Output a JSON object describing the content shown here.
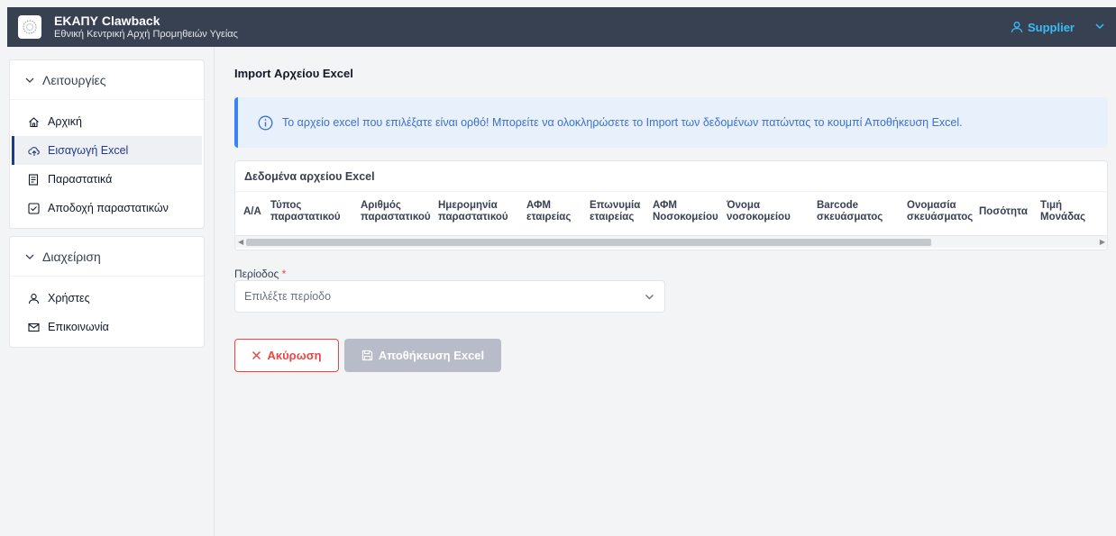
{
  "header": {
    "title": "ΕΚΑΠΥ Clawback",
    "subtitle": "Εθνική Κεντρική Αρχή Προμηθειών Υγείας",
    "user_label": "Supplier"
  },
  "sidebar": {
    "sections": [
      {
        "title": "Λειτουργίες",
        "items": [
          {
            "label": "Αρχική",
            "icon": "home-icon"
          },
          {
            "label": "Εισαγωγή Excel",
            "icon": "cloud-upload-icon",
            "active": true
          },
          {
            "label": "Παραστατικά",
            "icon": "receipt-icon"
          },
          {
            "label": "Αποδοχή παραστατικών",
            "icon": "check-square-icon"
          }
        ]
      },
      {
        "title": "Διαχείριση",
        "items": [
          {
            "label": "Χρήστες",
            "icon": "user-icon"
          },
          {
            "label": "Επικοινωνία",
            "icon": "mail-icon"
          }
        ]
      }
    ]
  },
  "main": {
    "page_title": "Import Αρχείου Excel",
    "alert_text": "Το αρχείο excel που επιλέξατε είναι ορθό! Μπορείτε να ολοκληρώσετε το Import των δεδομένων πατώντας το κουμπί Αποθήκευση Excel.",
    "table": {
      "title": "Δεδομένα αρχείου Excel",
      "columns": [
        [
          "Α/Α"
        ],
        [
          "Τύπος",
          "παραστατικού"
        ],
        [
          "Αριθμός",
          "παραστατικού"
        ],
        [
          "Ημερομηνία",
          "παραστατικού"
        ],
        [
          "ΑΦΜ",
          "εταιρείας"
        ],
        [
          "Επωνυμία",
          "εταιρείας"
        ],
        [
          "ΑΦΜ",
          "Νοσοκομείου"
        ],
        [
          "Όνομα",
          "νοσοκομείου"
        ],
        [
          "Barcode",
          "σκευάσματος"
        ],
        [
          "Ονομασία",
          "σκευάσματος"
        ],
        [
          "Ποσότητα"
        ],
        [
          "Τιμή",
          "Μονάδας"
        ]
      ]
    },
    "period_label": "Περίοδος",
    "period_required": "*",
    "period_placeholder": "Επιλέξτε περίοδο",
    "cancel_label": "Ακύρωση",
    "save_label": "Αποθήκευση Excel"
  },
  "colors": {
    "topbar": "#374151",
    "accent_blue": "#3b82f6",
    "danger": "#ef4444",
    "disabled": "#b8bcc8"
  }
}
